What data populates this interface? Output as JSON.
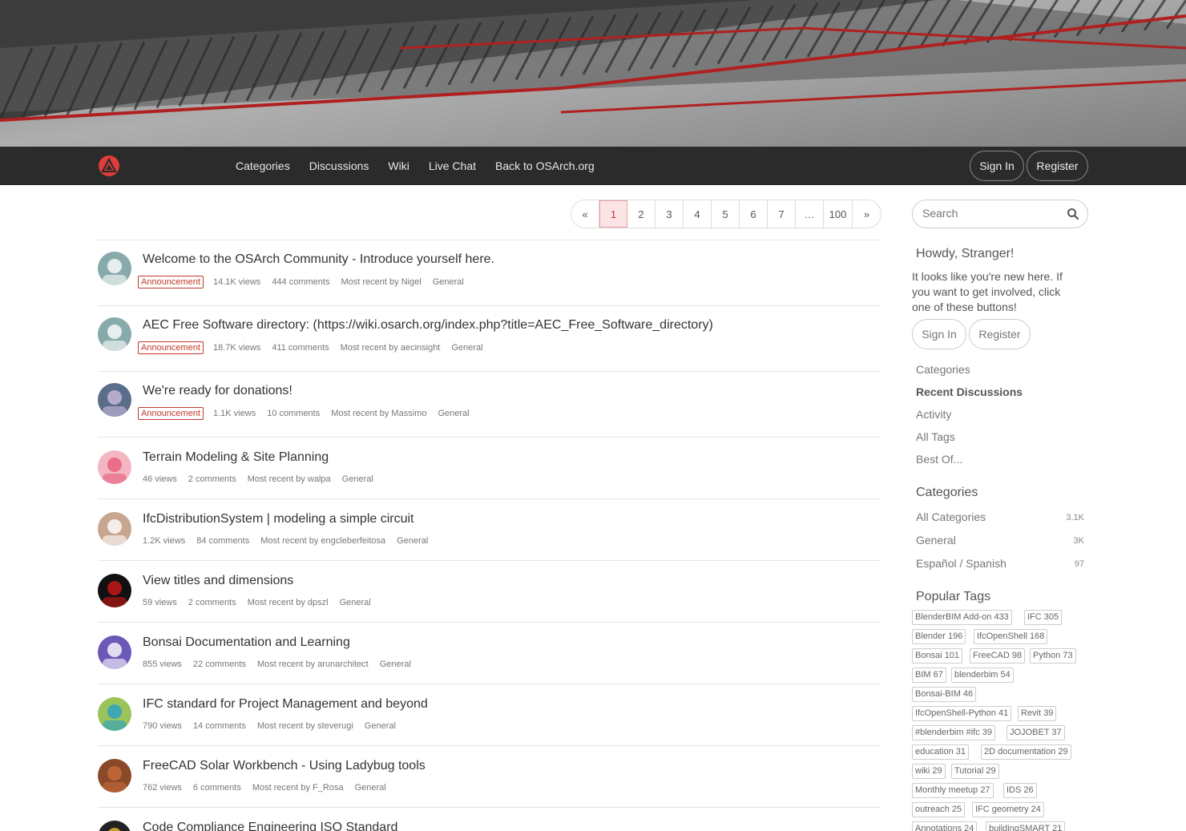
{
  "nav": {
    "links": [
      "Categories",
      "Discussions",
      "Wiki",
      "Live Chat",
      "Back to OSArch.org"
    ],
    "signin": "Sign In",
    "register": "Register"
  },
  "pager": [
    "«",
    "1",
    "2",
    "3",
    "4",
    "5",
    "6",
    "7",
    "…",
    "100",
    "»"
  ],
  "pager_active": "1",
  "discussions": [
    {
      "title": "Welcome to the OSArch Community - Introduce yourself here.",
      "badge": "Announcement",
      "views": "14.1K views",
      "comments": "444 comments",
      "recent": "Most recent by Nigel",
      "category": "General"
    },
    {
      "title": "AEC Free Software directory: (https://wiki.osarch.org/index.php?title=AEC_Free_Software_directory)",
      "badge": "Announcement",
      "views": "18.7K views",
      "comments": "411 comments",
      "recent": "Most recent by aecinsight",
      "category": "General"
    },
    {
      "title": "We're ready for donations!",
      "badge": "Announcement",
      "views": "1.1K views",
      "comments": "10 comments",
      "recent": "Most recent by Massimo",
      "category": "General"
    },
    {
      "title": "Terrain Modeling & Site Planning",
      "badge": "",
      "views": "46 views",
      "comments": "2 comments",
      "recent": "Most recent by walpa",
      "category": "General"
    },
    {
      "title": "IfcDistributionSystem | modeling a simple circuit",
      "badge": "",
      "views": "1.2K views",
      "comments": "84 comments",
      "recent": "Most recent by engcleberfeitosa",
      "category": "General"
    },
    {
      "title": "View titles and dimensions",
      "badge": "",
      "views": "59 views",
      "comments": "2 comments",
      "recent": "Most recent by dpszl",
      "category": "General"
    },
    {
      "title": "Bonsai Documentation and Learning",
      "badge": "",
      "views": "855 views",
      "comments": "22 comments",
      "recent": "Most recent by arunarchitect",
      "category": "General"
    },
    {
      "title": "IFC standard for Project Management and beyond",
      "badge": "",
      "views": "790 views",
      "comments": "14 comments",
      "recent": "Most recent by steverugi",
      "category": "General"
    },
    {
      "title": "FreeCAD Solar Workbench - Using Ladybug tools",
      "badge": "",
      "views": "762 views",
      "comments": "6 comments",
      "recent": "Most recent by F_Rosa",
      "category": "General"
    },
    {
      "title": "Code Compliance Engineering ISO Standard",
      "badge": "",
      "views": "",
      "comments": "",
      "recent": "",
      "category": ""
    }
  ],
  "sidebar": {
    "search_placeholder": "Search",
    "howdy": "Howdy, Stranger!",
    "howdy_text": "It looks like you're new here. If you want to get involved, click one of these buttons!",
    "signin": "Sign In",
    "register": "Register",
    "links": [
      "Categories",
      "Recent Discussions",
      "Activity",
      "All Tags",
      "Best Of..."
    ],
    "active_link": "Recent Discussions",
    "categories_heading": "Categories",
    "categories": [
      {
        "name": "All Categories",
        "count": "3.1K"
      },
      {
        "name": "General",
        "count": "3K"
      },
      {
        "name": "Español / Spanish",
        "count": "97"
      }
    ],
    "tags_heading": "Popular Tags",
    "tags": [
      "BlenderBIM Add-on 433",
      "IFC 305",
      "Blender 196",
      "IfcOpenShell 168",
      "Bonsai 101",
      "FreeCAD 98",
      "Python 73",
      "BIM 67",
      "blenderbim 54",
      "Bonsai-BIM 46",
      "IfcOpenShell-Python 41",
      "Revit 39",
      "#blenderbim #ifc 39",
      "JOJOBET 37",
      "education 31",
      "2D documentation 29",
      "wiki 29",
      "Tutorial 29",
      "Monthly meetup 27",
      "IDS 26",
      "outreach 25",
      "IFC geometry 24",
      "Annotations 24",
      "buildingSMART 21"
    ]
  },
  "colors": {
    "accent": "#c0392b",
    "navbar": "#2b2b2b",
    "active_page_bg": "#fce4e6"
  }
}
